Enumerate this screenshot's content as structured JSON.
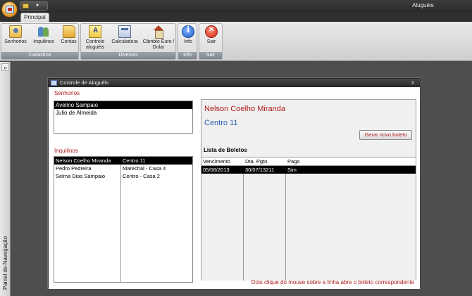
{
  "window": {
    "title": "Aluguéis"
  },
  "ribbon": {
    "tabs": [
      {
        "label": "Principal",
        "active": true
      }
    ],
    "groups": {
      "cadastros": {
        "label": "Cadastros",
        "buttons": [
          {
            "label": "Senhorios",
            "icon": "landlord-icon"
          },
          {
            "label": "Inquilinos",
            "icon": "tenants-icon"
          },
          {
            "label": "Contas",
            "icon": "folder-icon"
          }
        ]
      },
      "diversos": {
        "label": "Diversos",
        "buttons": [
          {
            "label": "Controle aluguéis",
            "icon": "rent-control-icon"
          },
          {
            "label": "Calculadora",
            "icon": "calculator-icon"
          },
          {
            "label": "Câmbio Euro / Dolar",
            "icon": "house-icon"
          }
        ]
      },
      "info": {
        "label": "Info",
        "buttons": [
          {
            "label": "Info",
            "icon": "info-icon"
          }
        ]
      },
      "sair": {
        "label": "Sair",
        "buttons": [
          {
            "label": "Sair",
            "icon": "exit-icon"
          }
        ]
      }
    }
  },
  "nav_pane": {
    "label": "Painel de Navegação",
    "toggle": "»"
  },
  "form": {
    "title": "Controle de Aluguéis",
    "close": "x",
    "senhorios": {
      "label": "Senhorios",
      "items": [
        {
          "name": "Avelino Sampaio",
          "selected": true
        },
        {
          "name": "Julio de Almeida",
          "selected": false
        }
      ]
    },
    "inquilinos": {
      "label": "Inquilinos",
      "rows": [
        {
          "nome": "Nelson Coelho Miranda",
          "imovel": "Centro 11",
          "selected": true
        },
        {
          "nome": "Pedro Pedreira",
          "imovel": "Marechal - Casa 4",
          "selected": false
        },
        {
          "nome": "Selma Dias Sampaio",
          "imovel": "Centro - Casa 2",
          "selected": false
        }
      ]
    },
    "detail": {
      "inquilino": "Nelson Coelho Miranda",
      "imovel": "Centro 11",
      "gerar_button": "Gerar novo boleto",
      "boletos_label": "Lista de Boletos",
      "columns": [
        "Vencimento",
        "Dta. Pgto",
        "Pago"
      ],
      "rows": [
        {
          "vencimento": "05/08/2013",
          "dta_pgto": "30/07/13211",
          "pago": "Sim",
          "selected": true
        }
      ]
    },
    "hint": "Dois clique do mouse sobre a linha abre o boleto correspondente"
  },
  "colors": {
    "accent_red": "#b01a1a",
    "accent_blue": "#2f5fb0",
    "selection": "#000000"
  }
}
